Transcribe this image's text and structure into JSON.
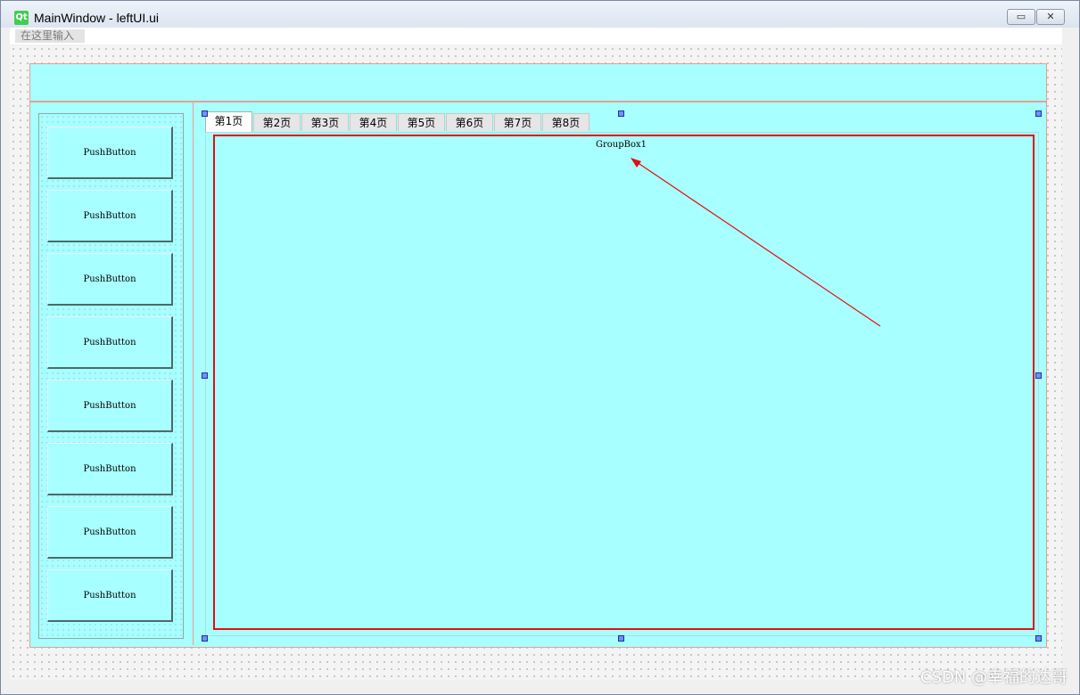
{
  "window": {
    "icon_text": "Qt",
    "title": "MainWindow - leftUI.ui",
    "minimize_label": "▭",
    "close_label": "✕"
  },
  "menubar": {
    "placeholder": "在这里输入"
  },
  "left_buttons": [
    {
      "label": "PushButton"
    },
    {
      "label": "PushButton"
    },
    {
      "label": "PushButton"
    },
    {
      "label": "PushButton"
    },
    {
      "label": "PushButton"
    },
    {
      "label": "PushButton"
    },
    {
      "label": "PushButton"
    },
    {
      "label": "PushButton"
    }
  ],
  "tabs": [
    {
      "label": "第1页",
      "active": true
    },
    {
      "label": "第2页"
    },
    {
      "label": "第3页"
    },
    {
      "label": "第4页"
    },
    {
      "label": "第5页"
    },
    {
      "label": "第6页"
    },
    {
      "label": "第7页"
    },
    {
      "label": "第8页"
    }
  ],
  "groupbox": {
    "title": "GroupBox1"
  },
  "watermark": "CSDN @幸福的达哥",
  "colors": {
    "panel": "#a8ffff",
    "highlight": "#e01010",
    "layout_border": "#e8a090"
  }
}
